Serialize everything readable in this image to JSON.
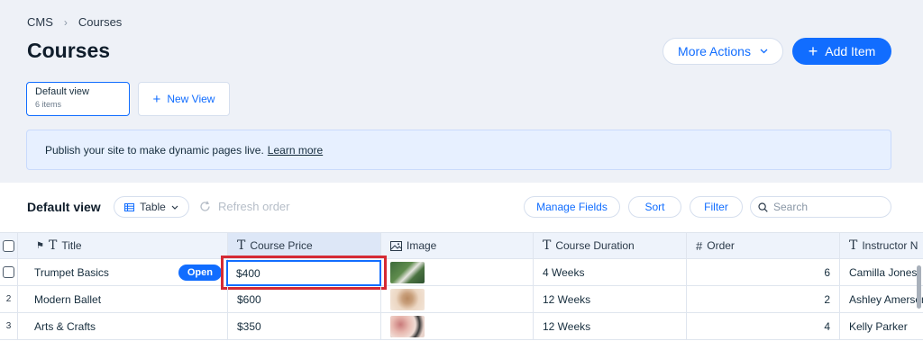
{
  "breadcrumb": {
    "root": "CMS",
    "current": "Courses"
  },
  "page": {
    "title": "Courses"
  },
  "actions": {
    "more_label": "More Actions",
    "add_label": "Add Item"
  },
  "views": {
    "active_name": "Default view",
    "active_count": "6 items",
    "new_label": "New View"
  },
  "banner": {
    "text": "Publish your site to make dynamic pages live.",
    "link": "Learn more"
  },
  "toolbar": {
    "view_title": "Default view",
    "layout_label": "Table",
    "refresh_label": "Refresh order",
    "manage_fields": "Manage Fields",
    "sort": "Sort",
    "filter": "Filter",
    "search_placeholder": "Search"
  },
  "columns": {
    "title": "Title",
    "price": "Course Price",
    "image": "Image",
    "duration": "Course Duration",
    "order": "Order",
    "instructor": "Instructor N"
  },
  "open_label": "Open",
  "rows": [
    {
      "num": "",
      "title": "Trumpet Basics",
      "price": "$400",
      "duration": "4 Weeks",
      "order": "6",
      "instructor": "Camilla Jones"
    },
    {
      "num": "2",
      "title": "Modern Ballet",
      "price": "$600",
      "duration": "12 Weeks",
      "order": "2",
      "instructor": "Ashley Amerson"
    },
    {
      "num": "3",
      "title": "Arts & Crafts",
      "price": "$350",
      "duration": "12 Weeks",
      "order": "4",
      "instructor": "Kelly Parker"
    }
  ],
  "colors": {
    "accent": "#116dff",
    "highlight_box": "#d52a34"
  }
}
